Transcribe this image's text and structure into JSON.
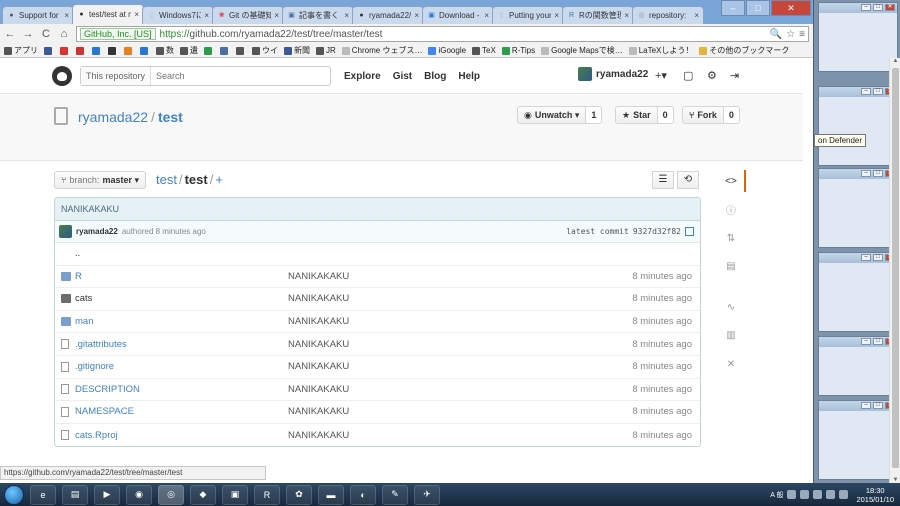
{
  "browser": {
    "tabs": [
      {
        "label": "Support for",
        "color": "#555",
        "glyph": "●"
      },
      {
        "label": "test/test at m",
        "color": "#333",
        "glyph": "●",
        "active": true
      },
      {
        "label": "Windows7に",
        "color": "#bbb",
        "glyph": "▯"
      },
      {
        "label": "Git の基礎知",
        "color": "#d33",
        "glyph": "❀"
      },
      {
        "label": "記事を書く - ",
        "color": "#4a6fa5",
        "glyph": "▣"
      },
      {
        "label": "ryamada22/te",
        "color": "#333",
        "glyph": "●"
      },
      {
        "label": "Download - T",
        "color": "#2a7ad5",
        "glyph": "▣"
      },
      {
        "label": "Putting your",
        "color": "#bbb",
        "glyph": "▯"
      },
      {
        "label": "Rの関数管理",
        "color": "#4a6fa5",
        "glyph": "R"
      },
      {
        "label": "repository: ",
        "color": "#999",
        "glyph": "◎"
      }
    ],
    "close_glyph": "×",
    "window_controls": {
      "minimize": "–",
      "maximize": "□",
      "close": "✕"
    },
    "nav": {
      "back": "←",
      "forward": "→",
      "reload": "C",
      "home": "⌂"
    },
    "ev_badge": "GitHub, Inc. [US]",
    "url_https": "https://",
    "url_rest": "github.com/ryamada22/test/tree/master/test",
    "omnibox_icons": [
      "🔍",
      "☆",
      "≡"
    ],
    "bookmarks": [
      {
        "label": "アプリ",
        "color": "#555"
      },
      {
        "label": "",
        "color": "#3b5998"
      },
      {
        "label": "",
        "color": "#d33"
      },
      {
        "label": "",
        "color": "#c33"
      },
      {
        "label": "",
        "color": "#2a7ad5"
      },
      {
        "label": "",
        "color": "#333"
      },
      {
        "label": "",
        "color": "#e67e22"
      },
      {
        "label": "",
        "color": "#2a7ad5"
      },
      {
        "label": "数",
        "color": "#555"
      },
      {
        "label": "遺",
        "color": "#555"
      },
      {
        "label": "",
        "color": "#2a9d4a"
      },
      {
        "label": "",
        "color": "#4a6fa5"
      },
      {
        "label": "",
        "color": "#555"
      },
      {
        "label": "ウイ",
        "color": "#555"
      },
      {
        "label": "新聞",
        "color": "#3b5998"
      },
      {
        "label": "JR",
        "color": "#555"
      },
      {
        "label": "Chrome ウェブス…",
        "color": "#bbb"
      },
      {
        "label": "iGoogle",
        "color": "#4285f4"
      },
      {
        "label": "TeX",
        "color": "#555"
      },
      {
        "label": "R-Tips",
        "color": "#2a9d4a"
      },
      {
        "label": "Google Mapsで検…",
        "color": "#bbb"
      },
      {
        "label": "LaTeXしよう！",
        "color": "#bbb"
      },
      {
        "label": "その他のブックマーク",
        "color": "#e5b53a"
      }
    ],
    "status_url": "https://github.com/ryamada22/test/tree/master/test"
  },
  "github": {
    "scope_label": "This repository",
    "search_placeholder": "Search",
    "nav": [
      "Explore",
      "Gist",
      "Blog",
      "Help"
    ],
    "username": "ryamada22",
    "icons": {
      "create": "+▾",
      "inbox": "▢",
      "settings": "⚙",
      "signout": "⇥"
    },
    "repo_owner": "ryamada22",
    "repo_sep": "/",
    "repo_name": "test",
    "watch": {
      "label": "Unwatch ▾",
      "count": "1",
      "glyph": "◉"
    },
    "star": {
      "label": "Star",
      "count": "0",
      "glyph": "★"
    },
    "fork": {
      "label": "Fork",
      "count": "0",
      "glyph": "⑂"
    },
    "branch_label": "branch:",
    "branch_value": "master ▾",
    "crumb_root": "test",
    "crumb_current": "test",
    "crumb_add": "+",
    "list_view_glyph": "☰",
    "history_glyph": "⟲",
    "commit_title": "NANIKAKAKU",
    "commit_author": "ryamada22",
    "commit_when": "authored 8 minutes ago",
    "latest_commit_label": "latest commit",
    "latest_commit_sha": "9327d32f82",
    "parent_dir": "..",
    "files": [
      {
        "name": "R",
        "type": "folder",
        "message": "NANIKAKAKU",
        "age": "8 minutes ago"
      },
      {
        "name": "cats",
        "type": "folder-dark",
        "message": "NANIKAKAKU",
        "age": "8 minutes ago"
      },
      {
        "name": "man",
        "type": "folder",
        "message": "NANIKAKAKU",
        "age": "8 minutes ago"
      },
      {
        "name": ".gitattributes",
        "type": "file",
        "message": "NANIKAKAKU",
        "age": "8 minutes ago"
      },
      {
        "name": ".gitignore",
        "type": "file",
        "message": "NANIKAKAKU",
        "age": "8 minutes ago"
      },
      {
        "name": "DESCRIPTION",
        "type": "file",
        "message": "NANIKAKAKU",
        "age": "8 minutes ago"
      },
      {
        "name": "NAMESPACE",
        "type": "file",
        "message": "NANIKAKAKU",
        "age": "8 minutes ago"
      },
      {
        "name": "cats.Rproj",
        "type": "file",
        "message": "NANIKAKAKU",
        "age": "8 minutes ago"
      }
    ],
    "side_nav": [
      {
        "name": "code",
        "glyph": "<>",
        "active": true
      },
      {
        "name": "issues",
        "glyph": "ⓘ"
      },
      {
        "name": "pull-requests",
        "glyph": "⇅"
      },
      {
        "name": "wiki",
        "glyph": "▤"
      },
      {
        "name": "pulse",
        "glyph": "∿"
      },
      {
        "name": "graphs",
        "glyph": "▥"
      },
      {
        "name": "settings",
        "glyph": "✕"
      }
    ]
  },
  "desktop": {
    "tooltip": "on Defender",
    "clock_time": "18:30",
    "clock_date": "2015/01/10",
    "tray_text": "A 般",
    "taskbar_apps": [
      "e",
      "▤",
      "▶",
      "◉",
      "◎",
      "◆",
      "▣",
      "R",
      "✿",
      "▬",
      "◐",
      "✎",
      "✈"
    ]
  }
}
